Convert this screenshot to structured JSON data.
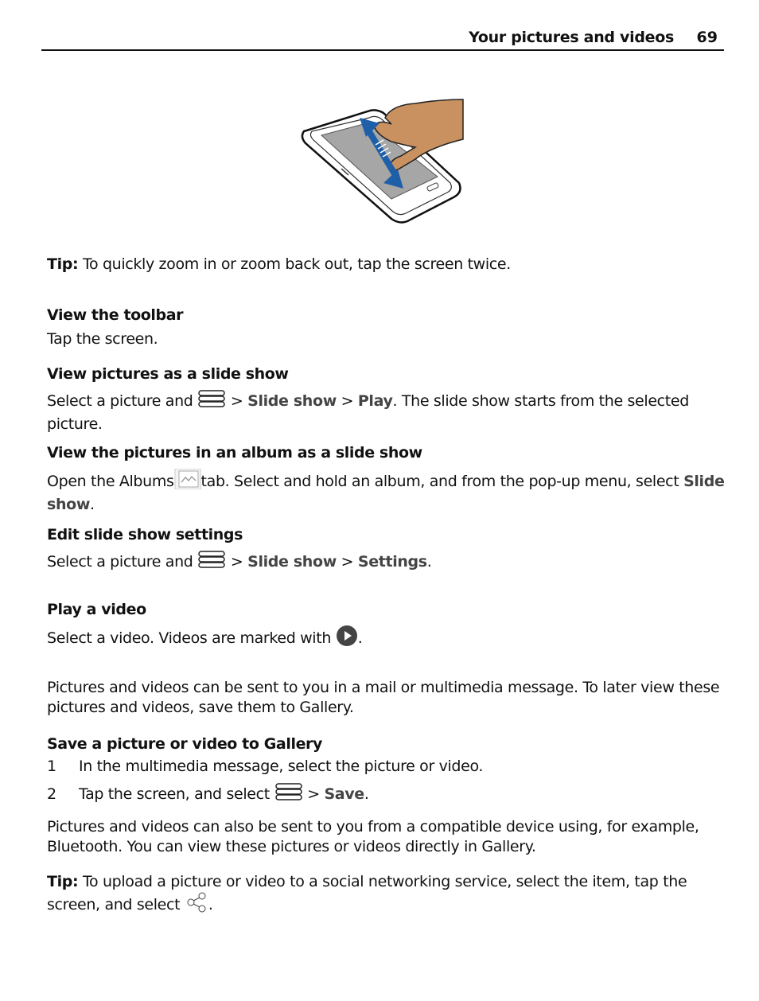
{
  "header": {
    "title": "Your pictures and videos",
    "page_number": "69"
  },
  "illustration": {
    "alt": "Hand using two fingers on a phone touch screen with a blue double-headed arrow indicating pinch zoom"
  },
  "tip1": {
    "label": "Tip:",
    "text": " To quickly zoom in or zoom back out, tap the screen twice."
  },
  "sections": {
    "toolbar": {
      "heading": "View the toolbar",
      "body": "Tap the screen."
    },
    "slideshow": {
      "heading": "View pictures as a slide show",
      "pre": "Select a picture and ",
      "sep1": " > ",
      "item1": "Slide show",
      "sep2": "  > ",
      "item2": "Play",
      "post": ". The slide show starts from the selected picture."
    },
    "album_slideshow": {
      "heading": "View the pictures in an album as a slide show",
      "pre": "Open the Albums",
      "post": "tab. Select and hold an album, and from the pop-up menu, select ",
      "item": "Slide show",
      "end": "."
    },
    "settings": {
      "heading": "Edit slide show settings",
      "pre": "Select a picture and ",
      "sep1": " > ",
      "item1": "Slide show",
      "sep2": "  > ",
      "item2": "Settings",
      "end": "."
    },
    "video": {
      "heading": "Play a video",
      "pre": "Select a video. Videos are marked with ",
      "end": "."
    },
    "intro": {
      "body": "Pictures and videos can be sent to you in a mail or multimedia message. To later view these pictures and videos, save them to Gallery."
    },
    "save": {
      "heading": "Save a picture or video to Gallery",
      "steps": [
        {
          "num": "1",
          "text": "In the multimedia message, select the picture or video."
        },
        {
          "num": "2",
          "pre": "Tap the screen, and select ",
          "sep": " > ",
          "item": "Save",
          "end": "."
        }
      ]
    },
    "bluetooth": {
      "body": "Pictures and videos can also be sent to you from a compatible device using, for example, Bluetooth. You can view these pictures or videos directly in Gallery."
    },
    "tip2": {
      "label": "Tip:",
      "text": " To upload a picture or video to a social networking service, select the item, tap the screen, and select ",
      "end": "."
    }
  },
  "icons": {
    "menu": "options-menu-icon",
    "albums": "albums-tab-icon",
    "play": "video-play-icon",
    "share": "share-icon"
  },
  "colors": {
    "text": "#111111",
    "ui_term": "#444444",
    "arrow_blue": "#1f5fa8",
    "hand": "#c8915f",
    "screen": "#a6a6a6"
  }
}
